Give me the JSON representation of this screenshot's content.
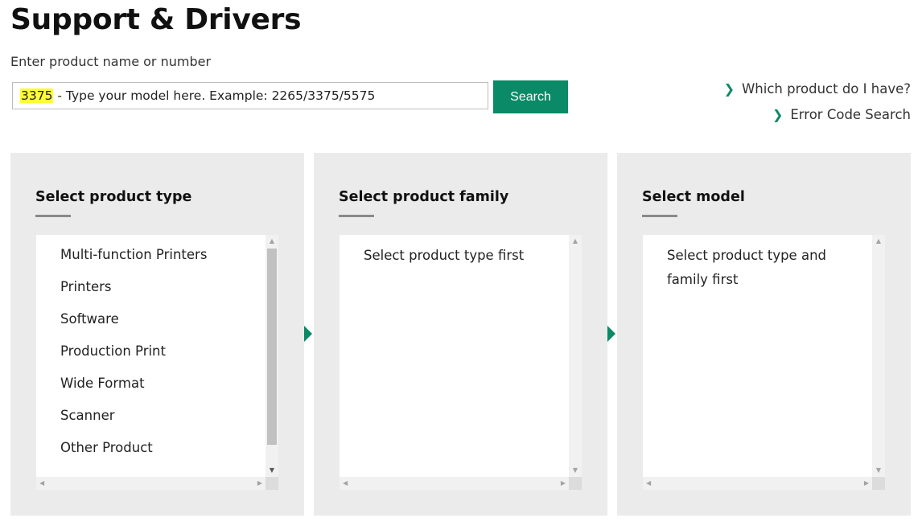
{
  "header": {
    "title": "Support & Drivers"
  },
  "search": {
    "label": "Enter product name or number",
    "value_highlight": "3375",
    "value_rest": " - Type your model here. Example: 2265/3375/5575",
    "button_label": "Search"
  },
  "help_links": [
    {
      "label": "Which product do I have?",
      "icon": "chevron-right-icon"
    },
    {
      "label": "Error Code Search",
      "icon": "chevron-right-icon"
    }
  ],
  "panels": {
    "product_type": {
      "heading": "Select product type",
      "items": [
        "Multi-function Printers",
        "Printers",
        "Software",
        "Production Print",
        "Wide Format",
        "Scanner",
        "Other Product"
      ]
    },
    "product_family": {
      "heading": "Select product family",
      "placeholder": "Select product type first"
    },
    "model": {
      "heading": "Select model",
      "placeholder_line1": "Select product type and",
      "placeholder_line2": "family first"
    }
  },
  "colors": {
    "accent": "#0a8a66",
    "highlight": "#ffff33",
    "panel_background": "#ebebeb"
  }
}
